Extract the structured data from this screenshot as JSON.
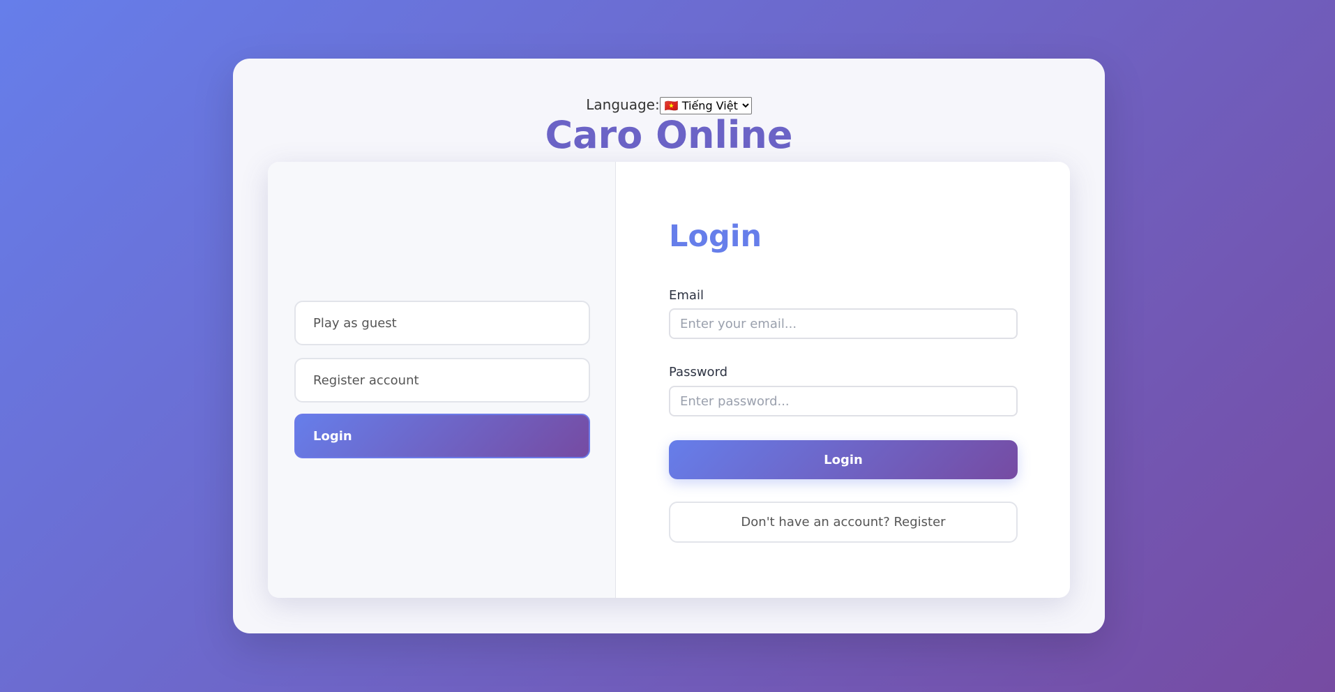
{
  "header": {
    "language_label": "Language:",
    "language_selected": "🇻🇳 Tiếng Việt",
    "title": "Caro Online"
  },
  "sidebar": {
    "items": [
      {
        "label": "Play as guest"
      },
      {
        "label": "Register account"
      },
      {
        "label": "Login",
        "active": true
      }
    ]
  },
  "form": {
    "title": "Login",
    "email_label": "Email",
    "email_placeholder": "Enter your email...",
    "password_label": "Password",
    "password_placeholder": "Enter password...",
    "submit_label": "Login",
    "register_link": "Don't have an account? Register"
  },
  "colors": {
    "accent": "#667eea",
    "accent_end": "#764ba2"
  }
}
